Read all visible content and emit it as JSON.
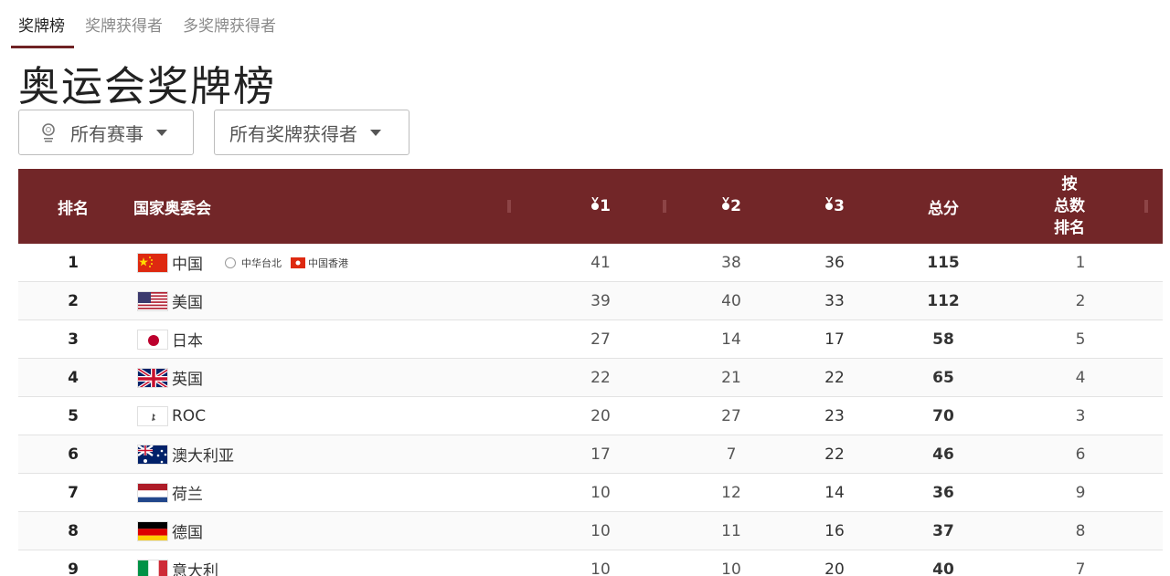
{
  "tabs": [
    {
      "label": "奖牌榜",
      "active": true
    },
    {
      "label": "奖牌获得者",
      "active": false
    },
    {
      "label": "多奖牌获得者",
      "active": false
    }
  ],
  "page_title": "奥运会奖牌榜",
  "filters": {
    "events": "所有赛事",
    "winners": "所有奖牌获得者"
  },
  "table": {
    "headers": {
      "rank": "排名",
      "noc": "国家奥委会",
      "gold": "1",
      "silver": "2",
      "bronze": "3",
      "total": "总分",
      "rank_by_total": "按\n总数\n排名"
    },
    "rows": [
      {
        "rank": "1",
        "country": "中国",
        "flag": "cn",
        "gold": "41",
        "silver": "38",
        "bronze": "36",
        "total": "115",
        "total_rank": "1"
      },
      {
        "rank": "2",
        "country": "美国",
        "flag": "us",
        "gold": "39",
        "silver": "40",
        "bronze": "33",
        "total": "112",
        "total_rank": "2"
      },
      {
        "rank": "3",
        "country": "日本",
        "flag": "jp",
        "gold": "27",
        "silver": "14",
        "bronze": "17",
        "total": "58",
        "total_rank": "5"
      },
      {
        "rank": "4",
        "country": "英国",
        "flag": "gb",
        "gold": "22",
        "silver": "21",
        "bronze": "22",
        "total": "65",
        "total_rank": "4"
      },
      {
        "rank": "5",
        "country": "ROC",
        "flag": "roc",
        "gold": "20",
        "silver": "27",
        "bronze": "23",
        "total": "70",
        "total_rank": "3"
      },
      {
        "rank": "6",
        "country": "澳大利亚",
        "flag": "au",
        "gold": "17",
        "silver": "7",
        "bronze": "22",
        "total": "46",
        "total_rank": "6"
      },
      {
        "rank": "7",
        "country": "荷兰",
        "flag": "nl",
        "gold": "10",
        "silver": "12",
        "bronze": "14",
        "total": "36",
        "total_rank": "9"
      },
      {
        "rank": "8",
        "country": "德国",
        "flag": "de",
        "gold": "10",
        "silver": "11",
        "bronze": "16",
        "total": "37",
        "total_rank": "8"
      },
      {
        "rank": "9",
        "country": "意大利",
        "flag": "it",
        "gold": "10",
        "silver": "10",
        "bronze": "20",
        "total": "40",
        "total_rank": "7"
      }
    ],
    "extra_row1": {
      "tpe": "中华台北",
      "hkg": "中国香港"
    }
  },
  "colors": {
    "header_bg": "#722628",
    "accent": "#6f2224"
  },
  "icons": {
    "olympic_rings": "olympic-rings-icon",
    "caret": "caret-down-icon",
    "medal": "medal-icon"
  }
}
